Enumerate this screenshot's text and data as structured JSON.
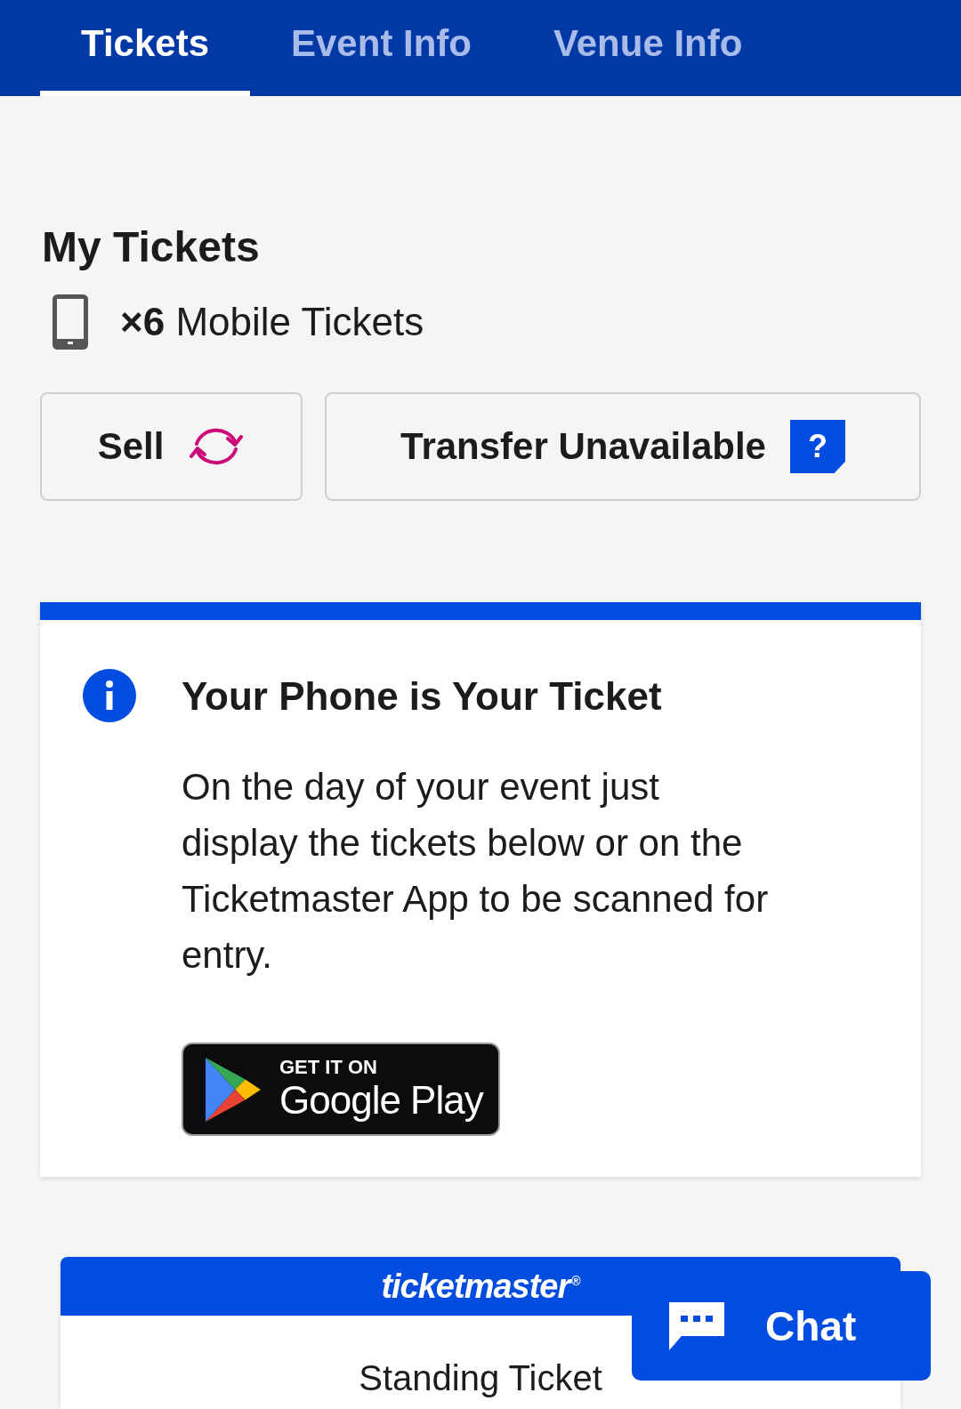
{
  "tabs": [
    {
      "label": "Tickets",
      "selected": true
    },
    {
      "label": "Event Info",
      "selected": false
    },
    {
      "label": "Venue Info",
      "selected": false
    }
  ],
  "my_tickets": {
    "title": "My Tickets",
    "count_line": "**×6** Mobile Tickets",
    "actions": [
      {
        "kind": "sell",
        "label": "Sell"
      },
      {
        "kind": "help",
        "label": "Transfer Unavailable",
        "badge": "?"
      }
    ]
  },
  "info_card": {
    "title": "Your Phone is Your Ticket",
    "body": "On the day of your event just\ndisplay the tickets below or on the\nTicketmaster App to be scanned for\nentry.",
    "store_badge": {
      "small": "GET IT ON",
      "large": "Google Play"
    }
  },
  "ticket": {
    "brand": "ticketmaster$^{®}$",
    "type": "Standing Ticket"
  },
  "chat_button": {
    "label": "Chat"
  }
}
